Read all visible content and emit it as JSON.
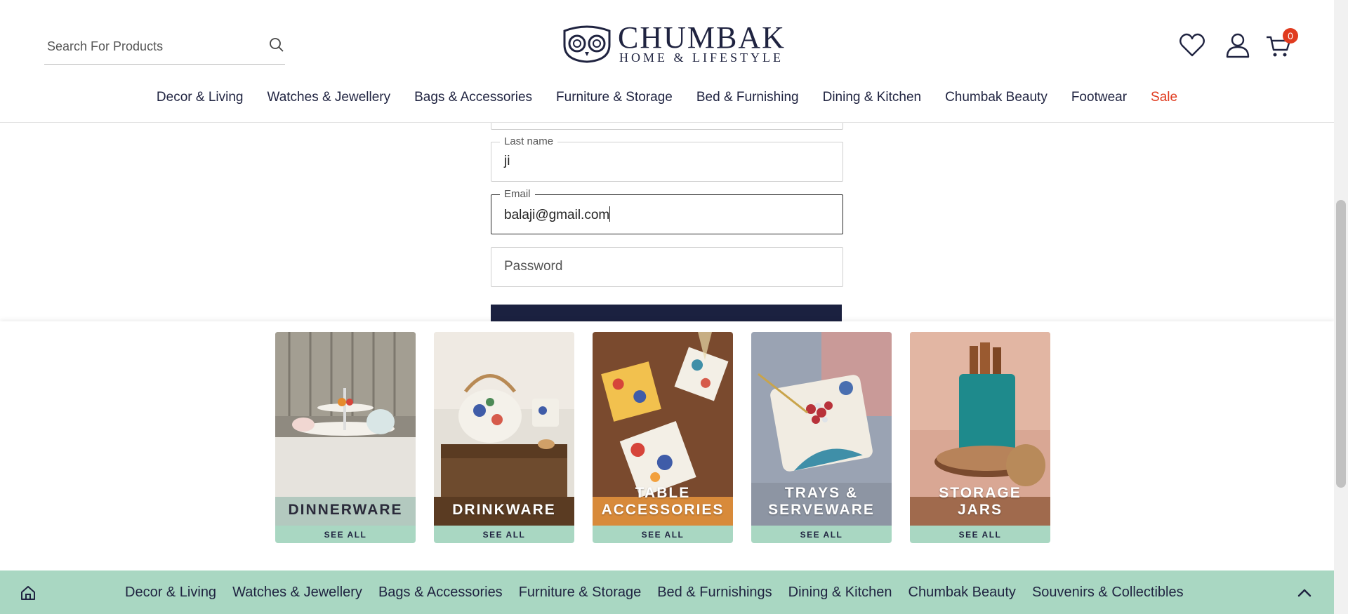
{
  "header": {
    "search_placeholder": "Search For Products",
    "logo_line1": "CHUMBAK",
    "logo_line2": "HOME & LIFESTYLE",
    "cart_count": "0",
    "nav": [
      "Decor & Living",
      "Watches & Jewellery",
      "Bags & Accessories",
      "Furniture & Storage",
      "Bed & Furnishing",
      "Dining & Kitchen",
      "Chumbak Beauty",
      "Footwear",
      "Sale"
    ]
  },
  "form": {
    "last_name_label": "Last name",
    "last_name_value": "ji",
    "email_label": "Email",
    "email_value": "balaji@gmail.com",
    "password_placeholder": "Password"
  },
  "categories": [
    {
      "line1": "DINNERWARE",
      "line2": "",
      "cta": "SEE ALL"
    },
    {
      "line1": "DRINKWARE",
      "line2": "",
      "cta": "SEE ALL"
    },
    {
      "line1": "TABLE",
      "line2": "ACCESSORIES",
      "cta": "SEE ALL"
    },
    {
      "line1": "TRAYS &",
      "line2": "SERVEWARE",
      "cta": "SEE ALL"
    },
    {
      "line1": "STORAGE",
      "line2": "JARS",
      "cta": "SEE ALL"
    }
  ],
  "footer": {
    "links": [
      "Decor & Living",
      "Watches & Jewellery",
      "Bags & Accessories",
      "Furniture & Storage",
      "Bed & Furnishings",
      "Dining & Kitchen",
      "Chumbak Beauty",
      "Souvenirs & Collectibles"
    ]
  },
  "colors": {
    "brand_navy": "#1f2340",
    "sale_red": "#e03b1f",
    "mint": "#a9d7c2"
  },
  "icons": [
    "search-icon",
    "owl-logo-icon",
    "heart-icon",
    "user-icon",
    "cart-icon",
    "home-icon",
    "chevron-up-icon"
  ]
}
